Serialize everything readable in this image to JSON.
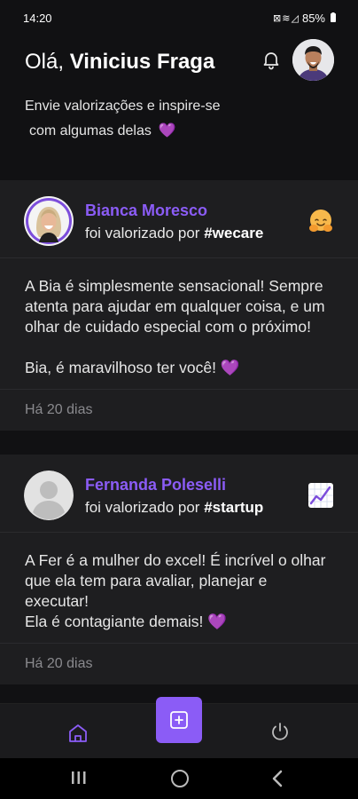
{
  "status": {
    "time": "14:20",
    "icons": "⊠ ≋ ◿",
    "battery": "85%"
  },
  "header": {
    "greeting_prefix": "Olá, ",
    "user_name": "Vinicius Fraga",
    "subtitle_line1": "Envie valorizações e inspire-se",
    "subtitle_line2": "com algumas delas",
    "subtitle_emoji": "💜"
  },
  "posts": [
    {
      "name": "Bianca Moresco",
      "by_prefix": "foi valorizado por ",
      "tag": "#wecare",
      "tag_icon": "hugging-face-icon",
      "message": "A Bia é simplesmente sensacional! Sempre atenta para ajudar em qualquer coisa, e um olhar de cuidado especial com o próximo!\n\nBia, é maravilhoso ter você!",
      "message_emoji": "💜",
      "time": "Há 20 dias"
    },
    {
      "name": "Fernanda Poleselli",
      "by_prefix": "foi valorizado por ",
      "tag": "#startup",
      "tag_icon": "chart-up-icon",
      "message": "A Fer é a mulher do excel! É incrível o olhar que ela tem para avaliar, planejar e executar!\nEla é contagiante demais!",
      "message_emoji": "💜",
      "time": "Há 20 dias"
    }
  ],
  "colors": {
    "accent": "#8b5cf6",
    "background": "#111113",
    "card": "#1e1e20"
  }
}
